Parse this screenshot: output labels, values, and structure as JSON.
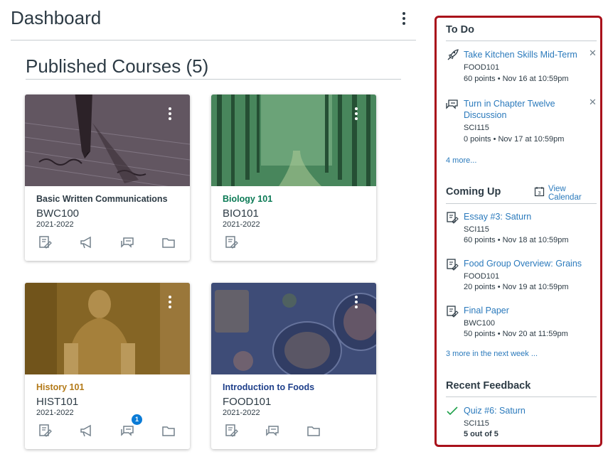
{
  "header": {
    "title": "Dashboard"
  },
  "section": {
    "title": "Published Courses (5)"
  },
  "courses": [
    {
      "name": "Basic Written Communications",
      "code": "BWC100",
      "term": "2021-2022",
      "name_color": "#2d3b45",
      "hero_tint": "#5a4a55",
      "actions": [
        "assignments-icon",
        "announcements-icon",
        "discussions-icon",
        "files-icon"
      ],
      "badge": ""
    },
    {
      "name": "Biology 101",
      "code": "BIO101",
      "term": "2021-2022",
      "name_color": "#0b7a55",
      "hero_tint": "#2f7a4f",
      "actions": [
        "assignments-icon"
      ],
      "badge": ""
    },
    {
      "name": "History 101",
      "code": "HIST101",
      "term": "2021-2022",
      "name_color": "#b37a18",
      "hero_tint": "#7a5a1a",
      "actions": [
        "assignments-icon",
        "announcements-icon",
        "discussions-icon",
        "files-icon"
      ],
      "badge": "1"
    },
    {
      "name": "Introduction to Foods",
      "code": "FOOD101",
      "term": "2021-2022",
      "name_color": "#1e3f8a",
      "hero_tint": "#3b4f8a",
      "actions": [
        "assignments-icon",
        "discussions-icon",
        "files-icon"
      ],
      "badge": ""
    }
  ],
  "sidebar": {
    "todo": {
      "heading": "To Do",
      "items": [
        {
          "icon": "rocket-icon",
          "title": "Take Kitchen Skills Mid-Term",
          "course": "FOOD101",
          "meta": "60 points • Nov 16 at 10:59pm"
        },
        {
          "icon": "discussion-icon",
          "title": "Turn in Chapter Twelve Discussion",
          "course": "SCI115",
          "meta": "0 points • Nov 17 at 10:59pm"
        }
      ],
      "more": "4 more..."
    },
    "coming_up": {
      "heading": "Coming Up",
      "view_calendar": "View Calendar",
      "calendar_day": "3",
      "items": [
        {
          "icon": "assignment-icon",
          "title": "Essay #3: Saturn",
          "course": "SCI115",
          "meta": "60 points • Nov 18 at 10:59pm"
        },
        {
          "icon": "assignment-icon",
          "title": "Food Group Overview: Grains",
          "course": "FOOD101",
          "meta": "20 points • Nov 19 at 10:59pm"
        },
        {
          "icon": "assignment-icon",
          "title": "Final Paper",
          "course": "BWC100",
          "meta": "50 points • Nov 20 at 11:59pm"
        }
      ],
      "more": "3 more in the next week ..."
    },
    "feedback": {
      "heading": "Recent Feedback",
      "items": [
        {
          "icon": "checkmark-icon",
          "title": "Quiz #6: Saturn",
          "course": "SCI115",
          "grade": "5 out of 5"
        }
      ]
    }
  },
  "colors": {
    "link": "#2b7abc",
    "sidebar_border": "#a9111b",
    "badge": "#0a7bd6",
    "check": "#1ea04a"
  }
}
